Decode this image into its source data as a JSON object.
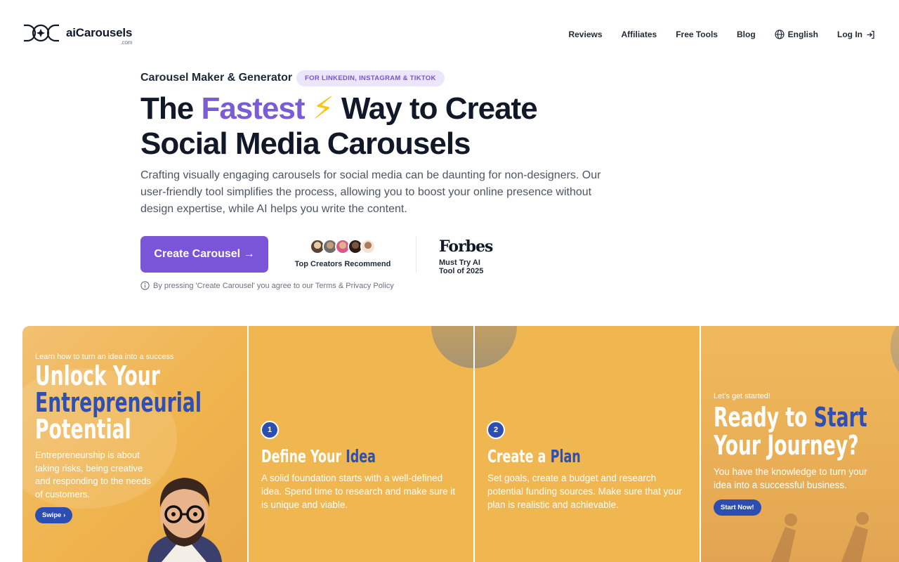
{
  "brand": {
    "name": "aiCarousels",
    "suffix": ".com"
  },
  "nav": {
    "items": [
      "Reviews",
      "Affiliates",
      "Free Tools",
      "Blog"
    ],
    "language": "English",
    "login": "Log In"
  },
  "hero": {
    "eyebrow_title": "Carousel Maker & Generator",
    "eyebrow_badge": "FOR LINKEDIN, INSTAGRAM & TIKTOK",
    "headline_pre": "The ",
    "headline_accent": "Fastest",
    "headline_bolt": "⚡",
    "headline_line1_post": " Way to Create",
    "headline_line2": "Social Media Carousels",
    "description": "Crafting visually engaging carousels for social media can be daunting for non-designers. Our user-friendly tool simplifies the process, allowing you to boost your online presence without design expertise, while AI helps you write the content.",
    "cta_label": "Create Carousel →",
    "creators_caption": "Top Creators Recommend",
    "forbes_logo": "Forbes",
    "forbes_caption": "Must Try AI Tool of 2025",
    "terms": "By pressing 'Create Carousel' you agree to our Terms & Privacy Policy",
    "avatar_colors": [
      "#c9a27e",
      "#8a6a55",
      "#d9588a",
      "#3a2a24",
      "#b07b57"
    ]
  },
  "slides": [
    {
      "kicker": "Learn how to turn an idea into a success",
      "title_1": "Unlock Your",
      "title_2": "Entrepreneurial",
      "title_3": "Potential",
      "body": "Entrepreneurship is about taking risks, being creative and responding to the needs of customers.",
      "button": "Swipe ›"
    },
    {
      "number": "1",
      "title_a": "Define Your ",
      "title_b": "Idea",
      "body": "A solid foundation starts with a well-defined idea. Spend time to research and make sure it is unique and viable."
    },
    {
      "number": "2",
      "title_a": "Create a ",
      "title_b": "Plan",
      "body": "Set goals, create a budget and research potential funding sources. Make sure that your plan is realistic and achievable."
    },
    {
      "kicker": "Let's get started!",
      "title_a": "Ready to ",
      "title_b": "Start",
      "title_c": "Your Journey?",
      "body": "You have the knowledge to turn your idea into a successful business.",
      "button": "Start Now!"
    }
  ],
  "colors": {
    "accent_purple": "#7b55d8",
    "slide_yellow": "#f0b64f",
    "slide_blue": "#2c4eb2"
  }
}
